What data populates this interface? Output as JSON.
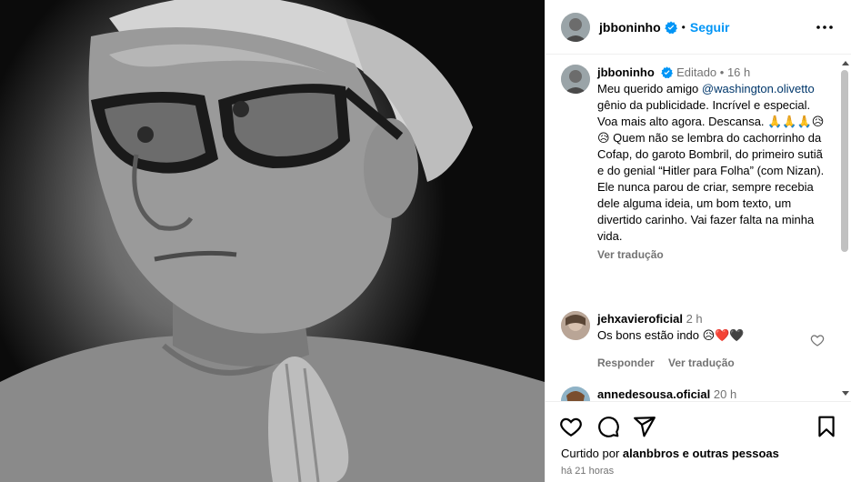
{
  "post": {
    "username": "jbboninho",
    "follow_label": "Seguir",
    "more_icon": "more-horizontal-icon"
  },
  "caption": {
    "username": "jbboninho",
    "edited": "Editado",
    "age": "16 h",
    "text_pre": "Meu querido amigo ",
    "mention": "@washington.olivetto",
    "text_post": " gênio da publicidade. Incrível e especial. Voa mais alto agora. Descansa. 🙏🙏🙏😥 😥 Quem não se lembra do cachorrinho da Cofap, do garoto Bombril, do primeiro sutiã e do genial “Hitler para Folha” (com Nizan). Ele nunca parou de criar, sempre recebia dele alguma ideia, um bom texto, um divertido carinho. Vai fazer falta na minha vida.",
    "translate": "Ver tradução"
  },
  "comments": [
    {
      "username": "jehxavieroficial",
      "age": "2 h",
      "text": "Os bons estão indo 😥❤️🖤",
      "reply": "Responder",
      "translate": "Ver tradução"
    },
    {
      "username": "annedesousa.oficial",
      "age": "20 h"
    }
  ],
  "footer": {
    "liked_prefix": "Curtido por ",
    "liked_user": "alanbbros",
    "liked_suffix": " e outras pessoas",
    "time": "há 21 horas"
  },
  "colors": {
    "accent": "#0095f6",
    "muted": "#737373",
    "mention": "#00376b",
    "border": "#efefef"
  }
}
